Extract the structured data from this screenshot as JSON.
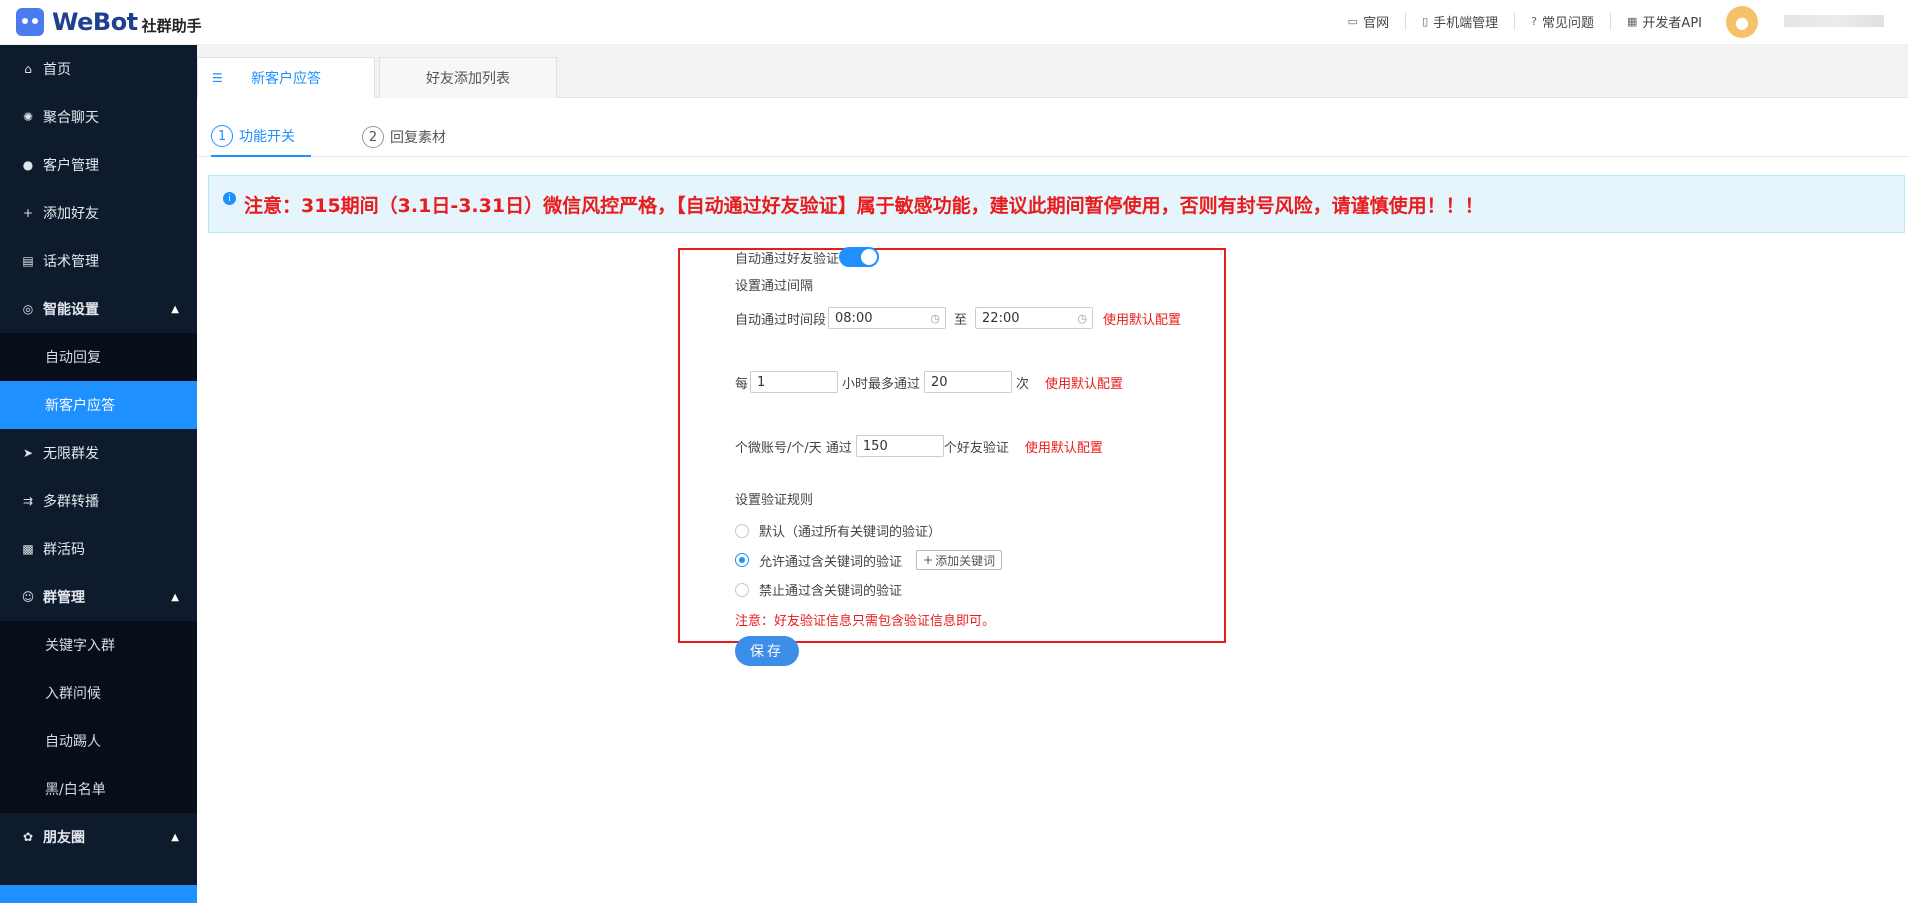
{
  "brand": {
    "name": "WeBot",
    "subtitle": "社群助手"
  },
  "header": {
    "links": [
      {
        "icon": "monitor-icon",
        "label": "官网"
      },
      {
        "icon": "phone-icon",
        "label": "手机端管理"
      },
      {
        "icon": "question-icon",
        "label": "常见问题"
      },
      {
        "icon": "grid-icon",
        "label": "开发者API"
      }
    ]
  },
  "sidebar": {
    "items": [
      {
        "label": "首页"
      },
      {
        "label": "聚合聊天"
      },
      {
        "label": "客户管理"
      },
      {
        "label": "添加好友"
      },
      {
        "label": "话术管理"
      }
    ],
    "group_smart": {
      "label": "智能设置",
      "subs": [
        "自动回复",
        "新客户应答"
      ]
    },
    "items2": [
      {
        "label": "无限群发"
      },
      {
        "label": "多群转播"
      },
      {
        "label": "群活码"
      }
    ],
    "group_manage": {
      "label": "群管理",
      "subs": [
        "关键字入群",
        "入群问候",
        "自动踢人",
        "黑/白名单"
      ]
    },
    "group_moments": {
      "label": "朋友圈"
    }
  },
  "tabs": {
    "active": "新客户应答",
    "inactive": "好友添加列表"
  },
  "steps": [
    {
      "num": "1",
      "label": "功能开关"
    },
    {
      "num": "2",
      "label": "回复素材"
    }
  ],
  "alert": {
    "text": "注意：315期间（3.1日-3.31日）微信风控严格，【自动通过好友验证】属于敏感功能，建议此期间暂停使用，否则有封号风险，请谨慎使用！！！"
  },
  "form": {
    "auto_pass_label": "自动通过好友验证",
    "auto_pass_on": true,
    "interval_title": "设置通过间隔",
    "time_range_label": "自动通过时间段",
    "time_start": "08:00",
    "to_label": "至",
    "time_end": "22:00",
    "use_default": "使用默认配置",
    "every_label": "每",
    "hours_value": "1",
    "hours_text": "小时最多通过",
    "max_value": "20",
    "times_text": "次",
    "per_account_label": "个微账号/个/天 通过",
    "per_account_value": "150",
    "per_account_suffix": "个好友验证",
    "rules_title": "设置验证规则",
    "rules": [
      {
        "label": "默认（通过所有关键词的验证）",
        "checked": false
      },
      {
        "label": "允许通过含关键词的验证",
        "checked": true
      },
      {
        "label": "禁止通过含关键词的验证",
        "checked": false
      }
    ],
    "add_keyword": "添加关键词",
    "note": "注意：好友验证信息只需包含验证信息即可。",
    "save": "保存"
  }
}
